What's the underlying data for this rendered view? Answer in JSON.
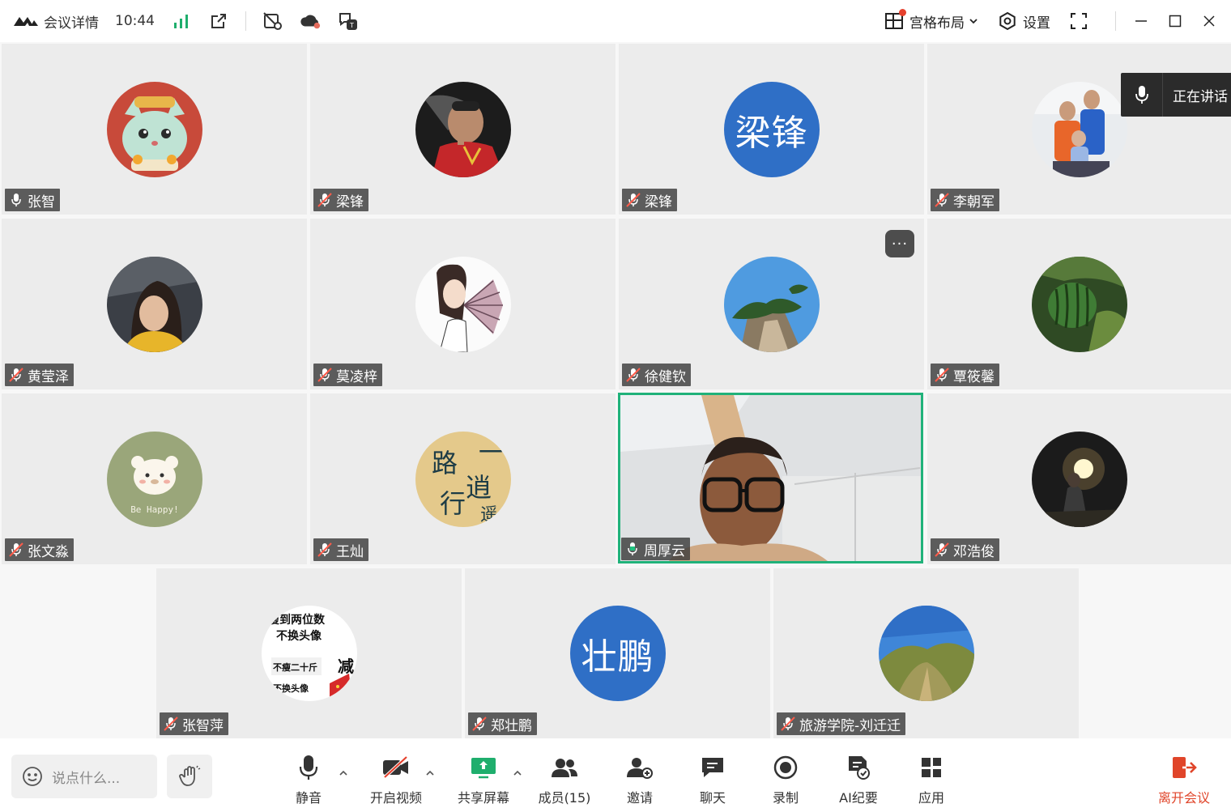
{
  "topbar": {
    "meeting_details": "会议详情",
    "time": "10:44",
    "layout_label": "宫格布局",
    "settings_label": "设置"
  },
  "speaking_indicator": {
    "label": "正在讲话"
  },
  "participants": [
    {
      "name": "张智",
      "avatar": "cartoon-cat",
      "muted": false
    },
    {
      "name": "梁锋",
      "avatar": "photo-soccer",
      "muted": true
    },
    {
      "name": "梁锋",
      "avatar_text": "梁锋",
      "muted": true
    },
    {
      "name": "李朝军",
      "avatar": "photo-family",
      "muted": true
    },
    {
      "name": "黄莹泽",
      "avatar": "photo-woman",
      "muted": true
    },
    {
      "name": "莫凌梓",
      "avatar": "illustration-fan",
      "muted": true
    },
    {
      "name": "徐健钦",
      "avatar": "photo-cliff",
      "muted": true
    },
    {
      "name": "覃筱馨",
      "avatar": "photo-melon",
      "muted": true
    },
    {
      "name": "张文淼",
      "avatar": "bear-happy",
      "muted": true
    },
    {
      "name": "王灿",
      "avatar": "calligraphy",
      "muted": true
    },
    {
      "name": "周厚云",
      "avatar": "video",
      "muted": false
    },
    {
      "name": "邓浩俊",
      "avatar": "photo-night",
      "muted": true
    },
    {
      "name": "张智萍",
      "avatar": "text-poster",
      "muted": true
    },
    {
      "name": "郑壮鹏",
      "avatar_text": "壮鹏",
      "muted": true
    },
    {
      "name": "旅游学院-刘迁迁",
      "avatar": "photo-hill",
      "muted": true
    }
  ],
  "avatar_texts": {
    "bear_caption": "Be Happy!",
    "calligraphy_chars": [
      "一",
      "路",
      "逍",
      "遥",
      "行"
    ],
    "poster_lines": [
      "瘦到两位数",
      "不换头像",
      "不瘦二十斤",
      "减",
      "不换头像"
    ]
  },
  "toolbar": {
    "chat_placeholder": "说点什么...",
    "mute": "静音",
    "start_video": "开启视频",
    "share_screen": "共享屏幕",
    "members": "成员(15)",
    "invite": "邀请",
    "chat": "聊天",
    "record": "录制",
    "ai_summary": "AI纪要",
    "apps": "应用",
    "leave": "离开会议"
  },
  "colors": {
    "accent_green": "#20b27a",
    "avatar_blue": "#2f6fc6",
    "leave_red": "#e0452a",
    "signal_green": "#1fae6d"
  }
}
